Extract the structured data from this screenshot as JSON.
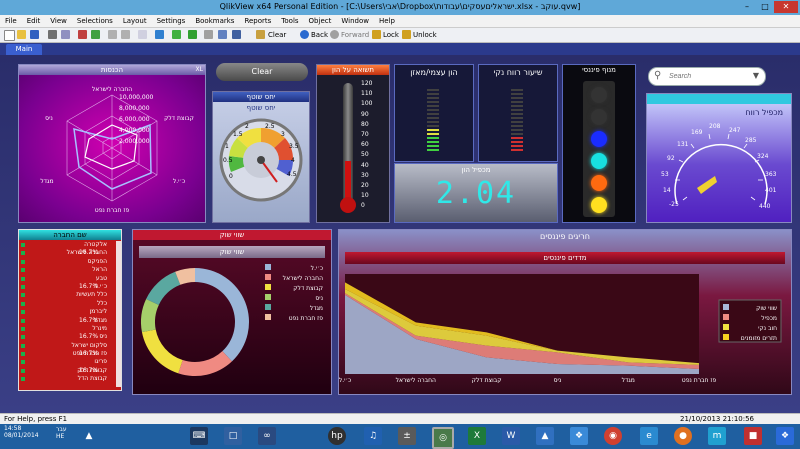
{
  "window": {
    "title": "QlikView x64 Personal Edition - [C:\\Users\\אבי\\Dropbox\\ישראליםעסקים\\עבודות.xlsx - עוקב.qvw]",
    "minimize": "–",
    "maximize": "□",
    "close": "✕"
  },
  "menu": [
    "File",
    "Edit",
    "View",
    "Selections",
    "Layout",
    "Settings",
    "Bookmarks",
    "Reports",
    "Tools",
    "Object",
    "Window",
    "Help"
  ],
  "toolbar": {
    "clear": "Clear",
    "back": "Back",
    "forward": "Forward",
    "lock": "Lock",
    "unlock": "Unlock"
  },
  "tabs": {
    "main": "Main"
  },
  "clear_button": "Clear",
  "radar": {
    "title": "הכנסות",
    "xl": "XL",
    "ticks": [
      "10,000,000",
      "8,000,000",
      "6,000,000",
      "4,000,000",
      "2,000,000"
    ],
    "labels": [
      "החברה לישראל",
      "קבוצת דלק",
      "כ׳י.ל",
      "פז חברת נפט",
      "מגדל",
      "ניס"
    ]
  },
  "gauge": {
    "title": "יחס שוטף",
    "label": "יחס שוטף",
    "ticks": [
      "0",
      "0.5",
      "1",
      "1.5",
      "2",
      "2.5",
      "3",
      "3.5",
      "4",
      "4.5"
    ]
  },
  "thermo": {
    "title": "תשואה על הון",
    "ticks": [
      "120",
      "110",
      "100",
      "90",
      "80",
      "70",
      "60",
      "50",
      "40",
      "30",
      "20",
      "10",
      "0"
    ]
  },
  "kpi1": {
    "title": "הון עצמי/מאזן"
  },
  "kpi2": {
    "title": "שיעור רווח נקי"
  },
  "led": {
    "title": "מנוף פיננסי",
    "colors": [
      "#333333",
      "#333333",
      "#1a2cff",
      "#18e0e0",
      "#ff6a10",
      "#ffe020"
    ]
  },
  "digital": {
    "title": "מכפיל הון",
    "value": "2.04"
  },
  "search": {
    "placeholder": "Search"
  },
  "speedo": {
    "title": "מכפיל רווח",
    "ticks": [
      "-25",
      "14",
      "53",
      "92",
      "131",
      "169",
      "208",
      "247",
      "285",
      "324",
      "363",
      "401",
      "440"
    ]
  },
  "listbox": {
    "title": "שם החברה",
    "rows": [
      {
        "name": "אלקטרה",
        "pct": ""
      },
      {
        "name": "החברה לישראל",
        "pct": "16.7%"
      },
      {
        "name": "הפניקס",
        "pct": ""
      },
      {
        "name": "הראל",
        "pct": ""
      },
      {
        "name": "טבע",
        "pct": ""
      },
      {
        "name": "כ׳י.ל",
        "pct": "16.7%"
      },
      {
        "name": "כלל תעשיות",
        "pct": ""
      },
      {
        "name": "כלל",
        "pct": ""
      },
      {
        "name": "ליברמן",
        "pct": ""
      },
      {
        "name": "מגדל",
        "pct": "16.7%"
      },
      {
        "name": "מינרל",
        "pct": ""
      },
      {
        "name": "ניס",
        "pct": "16.7%"
      },
      {
        "name": "סלקום ישראל",
        "pct": ""
      },
      {
        "name": "פז חברת נפט",
        "pct": "16.7%"
      },
      {
        "name": "פריגו",
        "pct": ""
      },
      {
        "name": "קבוצת דלק",
        "pct": "16.7%"
      },
      {
        "name": "קבוצת הדל",
        "pct": ""
      }
    ]
  },
  "donut": {
    "title": "שווי שוק",
    "subtitle": "שווי שוק"
  },
  "area": {
    "title": "חריגים פיננסים",
    "subtitle": "מדדים פיננסים"
  },
  "chart_data": [
    {
      "type": "pie",
      "title": "שווי שוק",
      "labels": [
        "כ׳י.ל",
        "החברה לישראל",
        "קבוצת דלק",
        "ניס",
        "מגדל",
        "פז חברת נפט"
      ],
      "values": [
        38,
        17,
        17,
        10,
        12,
        6
      ],
      "colors": [
        "#9ab6d8",
        "#f08a82",
        "#f0e040",
        "#a6cf6a",
        "#5aa8a0",
        "#f0c0a0"
      ]
    },
    {
      "type": "area",
      "title": "מדדים פיננסים",
      "categories": [
        "כ׳י.ל",
        "החברה לישראל",
        "קבוצת דלק",
        "ניס",
        "מגדל",
        "פז חברת נפט"
      ],
      "series": [
        {
          "name": "שווי שוק",
          "values": [
            95,
            42,
            20,
            12,
            10,
            6
          ],
          "color": "#a8b8d8"
        },
        {
          "name": "מכפיל",
          "values": [
            2,
            4,
            14,
            14,
            4,
            5
          ],
          "color": "#f08a82"
        },
        {
          "name": "חוב נקי",
          "values": [
            5,
            12,
            12,
            2,
            6,
            2
          ],
          "color": "#f0e040"
        },
        {
          "name": "תזרים מזומנים",
          "values": [
            8,
            4,
            4,
            0,
            0,
            0
          ],
          "color": "#f5d020"
        }
      ]
    }
  ],
  "status": {
    "left": "For Help, press F1",
    "right": "21/10/2013 21:10:56"
  },
  "taskbar": {
    "time": "14:58",
    "date": "08/01/2014",
    "lang": "עבר",
    "lang2": "HE"
  }
}
